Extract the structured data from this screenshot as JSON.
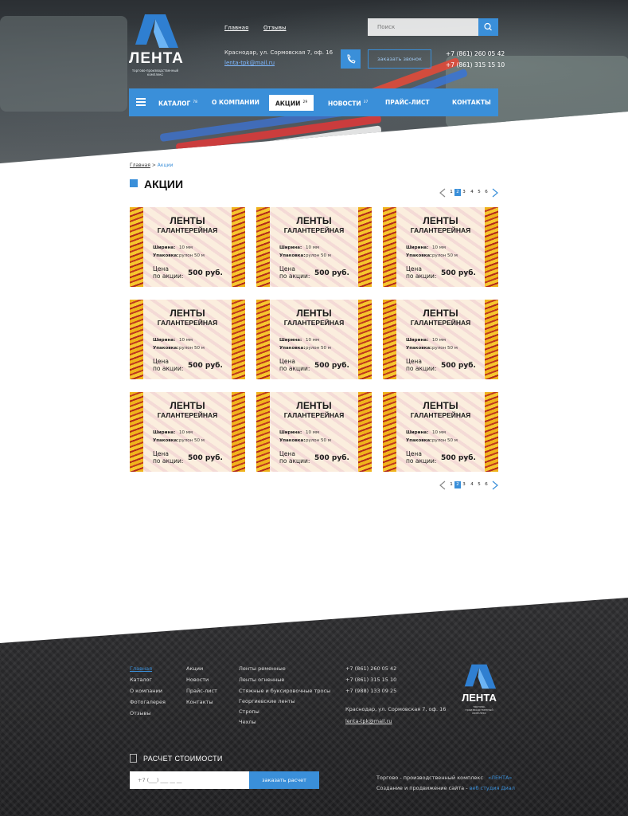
{
  "header": {
    "logo": {
      "word": "ЛЕНТА",
      "subtitle": "торгово-производственный комплекс"
    },
    "top_links": [
      "Главная",
      "Отзывы"
    ],
    "address": "Краснодар, ул. Сормовская 7, оф. 16",
    "email": "lenta-tpk@mail.ru",
    "search_placeholder": "Поиск",
    "order_call": "заказать звонок",
    "phones": [
      "+7 (861) 260 05 42",
      "+7 (861) 315 15 10"
    ]
  },
  "nav": {
    "items": [
      {
        "label": "Каталог",
        "count": "78"
      },
      {
        "label": "О компании",
        "count": ""
      },
      {
        "label": "Акции",
        "count": "29"
      },
      {
        "label": "Новости",
        "count": "37"
      },
      {
        "label": "Прайс-лист",
        "count": ""
      },
      {
        "label": "Контакты",
        "count": ""
      }
    ],
    "active_index": 2
  },
  "breadcrumb": {
    "home": "Главная",
    "separator": ">",
    "current": "Акции"
  },
  "page_title": "АКЦИИ",
  "pagination": {
    "pages": [
      "1",
      "2",
      "3",
      "4",
      "5",
      "6"
    ],
    "active": "2"
  },
  "card": {
    "title": "ЛЕНТЫ",
    "subtitle": "ГАЛАНТЕРЕЙНАЯ",
    "width_label": "Ширина:",
    "width_value": "10 мм",
    "pack_label": "Упаковка:",
    "pack_value": "рулон 50 м",
    "price_label_1": "Цена",
    "price_label_2": "по акции:",
    "price": "500 руб."
  },
  "cards_count": 9,
  "footer": {
    "col1": [
      "Главная",
      "Каталог",
      "О компании",
      "Фотогалерея",
      "Отзывы"
    ],
    "col2": [
      "Акции",
      "Новости",
      "Прайс-лист",
      "Контакты"
    ],
    "col3": [
      "Ленты ременные",
      "Ленты огненные",
      "Стяжные и буксировочные тросы",
      "Георгиевские ленты",
      "Стропы",
      "Чехлы"
    ],
    "phones": [
      "+7 (861) 260 05 42",
      "+7 (861) 315 15 10",
      "+7 (988) 133 09 25"
    ],
    "address": "Краснодар, ул. Сормовская 7, оф. 16",
    "email": "lenta-tpk@mail.ru",
    "logo": {
      "word": "ЛЕНТА",
      "subtitle": "торгово-производственный комплекс"
    },
    "calc_title": "Расчет стоимости",
    "calc_placeholder": "+7 (___) ___ __ __",
    "calc_button": "заказать расчет",
    "copy_line1": "Торгово - производственный комплекс",
    "copy_brand": "«ЛЕНТА»",
    "copy_line2": "Создание и продвижение сайта -",
    "copy_studio": "веб студия Диал"
  },
  "colors": {
    "accent": "#3a8fd9",
    "dark": "#1e1e20"
  }
}
